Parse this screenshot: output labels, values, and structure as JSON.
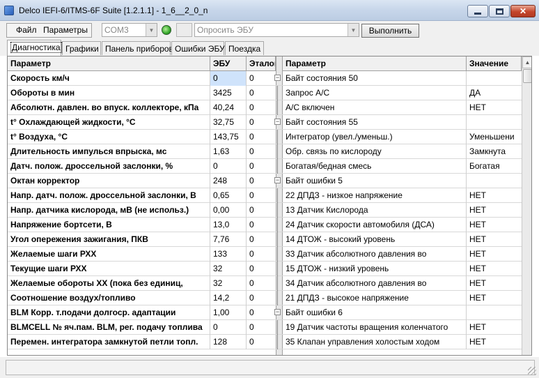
{
  "window": {
    "title": "Delco IEFI-6/ITMS-6F Suite [1.2.1.1] - 1_6__2_0_n"
  },
  "menu": {
    "file": "Файл",
    "params": "Параметры"
  },
  "toolbar": {
    "port": "COM3",
    "query": "Опросить ЭБУ",
    "run": "Выполнить"
  },
  "tabs": [
    "Диагностика",
    "Графики",
    "Панель приборов",
    "Ошибки ЭБУ",
    "Поездка"
  ],
  "left_table": {
    "headers": {
      "name": "Параметр",
      "ecu": "ЭБУ",
      "ref": "Эталон"
    },
    "rows": [
      {
        "name": "Скорость км/ч",
        "ecu": "0",
        "ref": "0"
      },
      {
        "name": "Обороты в мин",
        "ecu": "3425",
        "ref": "0"
      },
      {
        "name": "Абсолютн. давлен. во впуск. коллекторе, кПа",
        "ecu": "40,24",
        "ref": "0"
      },
      {
        "name": "t° Охлаждающей жидкости, °C",
        "ecu": "32,75",
        "ref": "0"
      },
      {
        "name": "t° Воздуха, °C",
        "ecu": "143,75",
        "ref": "0"
      },
      {
        "name": "Длительность импулься впрыска, мс",
        "ecu": "1,63",
        "ref": "0"
      },
      {
        "name": "Датч. полож. дроссельной заслонки, %",
        "ecu": "0",
        "ref": "0"
      },
      {
        "name": "Октан корректор",
        "ecu": "248",
        "ref": "0"
      },
      {
        "name": "Напр. датч. полож. дроссельной заслонки, В",
        "ecu": "0,65",
        "ref": "0"
      },
      {
        "name": "Напр. датчика кислорода, мВ (не использ.)",
        "ecu": "0,00",
        "ref": "0"
      },
      {
        "name": "Напряжение бортсети, В",
        "ecu": "13,0",
        "ref": "0"
      },
      {
        "name": "Угол опережения зажигания, ПКВ",
        "ecu": "7,76",
        "ref": "0"
      },
      {
        "name": "Желаемые шаги РХХ",
        "ecu": "133",
        "ref": "0"
      },
      {
        "name": "Текущие шаги РХХ",
        "ecu": "32",
        "ref": "0"
      },
      {
        "name": "Желаемые обороты ХХ (пока без единиц,",
        "ecu": "32",
        "ref": "0"
      },
      {
        "name": "Соотношение воздух/топливо",
        "ecu": "14,2",
        "ref": "0"
      },
      {
        "name": "BLM Корр. т.подачи долгоср. адаптации",
        "ecu": "1,00",
        "ref": "0"
      },
      {
        "name": "BLMCELL № яч.пам. BLM, рег. подачу топлива",
        "ecu": "0",
        "ref": "0"
      },
      {
        "name": "Перемен. интегратора замкнутой петли топл.",
        "ecu": "128",
        "ref": "0"
      }
    ]
  },
  "right_table": {
    "headers": {
      "name": "Параметр",
      "value": "Значение"
    },
    "rows": [
      {
        "name": "Байт состояния 50",
        "value": "",
        "group": true
      },
      {
        "name": "Запрос A/C",
        "value": "ДА"
      },
      {
        "name": "А/С включен",
        "value": "НЕТ"
      },
      {
        "name": "Байт состояния 55",
        "value": "",
        "group": true
      },
      {
        "name": "Интегратор (увел./уменьш.)",
        "value": "Уменьшени"
      },
      {
        "name": "Обр. связь по кислороду",
        "value": "Замкнута"
      },
      {
        "name": "Богатая/бедная смесь",
        "value": "Богатая"
      },
      {
        "name": "Байт ошибки 5",
        "value": "",
        "group": true
      },
      {
        "name": "22 ДПДЗ - низкое напряжение",
        "value": "НЕТ"
      },
      {
        "name": "13 Датчик Кислорода",
        "value": "НЕТ"
      },
      {
        "name": "24 Датчик скорости автомобиля (ДСА)",
        "value": "НЕТ"
      },
      {
        "name": "14 ДТОЖ - высокий уровень",
        "value": "НЕТ"
      },
      {
        "name": "33 Датчик абсолютного давления во",
        "value": "НЕТ"
      },
      {
        "name": "15 ДТОЖ - низкий уровень",
        "value": "НЕТ"
      },
      {
        "name": "34 Датчик абсолютного давления во",
        "value": "НЕТ"
      },
      {
        "name": "21 ДПДЗ - высокое напряжение",
        "value": "НЕТ"
      },
      {
        "name": "Байт ошибки 6",
        "value": "",
        "group": true
      },
      {
        "name": "19 Датчик частоты вращения коленчатого",
        "value": "НЕТ"
      },
      {
        "name": "35 Клапан управления холостым ходом",
        "value": "НЕТ"
      }
    ]
  },
  "status": {
    "text": ""
  }
}
